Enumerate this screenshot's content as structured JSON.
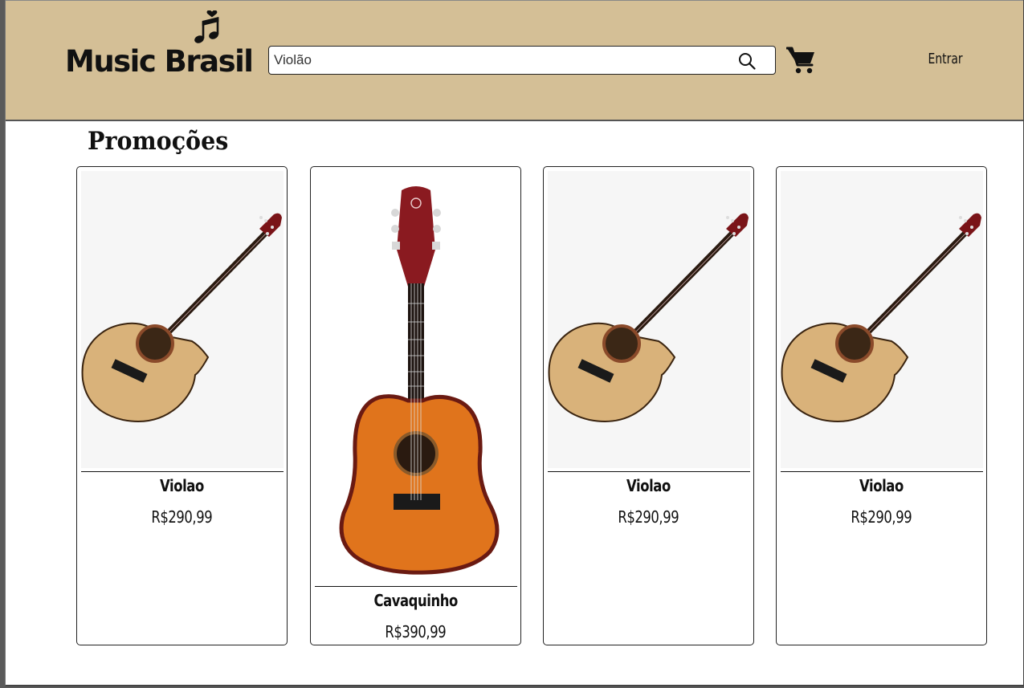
{
  "header": {
    "brand": "Music Brasil",
    "search": {
      "value": "Violão",
      "placeholder": "Violão"
    },
    "login_label": "Entrar"
  },
  "promotions": {
    "title": "Promoções",
    "products": [
      {
        "name": "Violao",
        "price": "R$290,99",
        "image_icon": "classical-guitar-image"
      },
      {
        "name": "Cavaquinho",
        "price": "R$390,99",
        "image_icon": "cavaquinho-image"
      },
      {
        "name": "Violao",
        "price": "R$290,99",
        "image_icon": "classical-guitar-image"
      },
      {
        "name": "Violao",
        "price": "R$290,99",
        "image_icon": "classical-guitar-image"
      }
    ]
  },
  "colors": {
    "header_bg": "#d4bf96",
    "page_bg": "#ffffff",
    "text": "#111111",
    "guitar_body": "#d9b27a",
    "cavaquinho_body": "#e0741c"
  }
}
